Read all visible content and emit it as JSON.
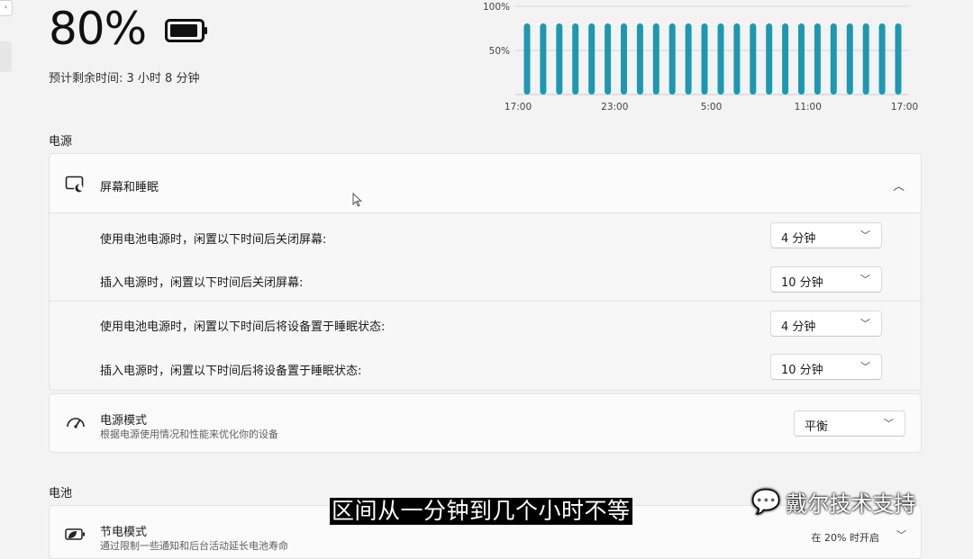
{
  "battery": {
    "percent": "80%",
    "remaining": "预计剩余时间: 3 小时 8 分钟"
  },
  "chart_data": {
    "type": "bar",
    "yticks": [
      "100%",
      "50%"
    ],
    "xticks": [
      "17:00",
      "23:00",
      "5:00",
      "11:00",
      "17:00"
    ],
    "values": [
      80,
      80,
      80,
      80,
      80,
      80,
      80,
      80,
      80,
      80,
      80,
      80,
      80,
      80,
      80,
      80,
      80,
      80,
      80,
      80,
      80,
      80,
      80,
      80
    ],
    "ylim": [
      0,
      100
    ],
    "bar_color": "#1e98b0",
    "grid": true
  },
  "power_section": {
    "label": "电源",
    "screen_sleep": {
      "title": "屏幕和睡眠",
      "expand_icon": "chevron-up-icon",
      "settings": [
        {
          "label": "使用电池电源时，闲置以下时间后关闭屏幕:",
          "value": "4 分钟"
        },
        {
          "label": "插入电源时，闲置以下时间后关闭屏幕:",
          "value": "10 分钟"
        },
        {
          "label": "使用电池电源时，闲置以下时间后将设备置于睡眠状态:",
          "value": "4 分钟"
        },
        {
          "label": "插入电源时，闲置以下时间后将设备置于睡眠状态:",
          "value": "10 分钟"
        }
      ]
    },
    "power_mode": {
      "title": "电源模式",
      "desc": "根据电源使用情况和性能来优化你的设备",
      "value": "平衡"
    }
  },
  "battery_section": {
    "label": "电池",
    "saver": {
      "title": "节电模式",
      "desc": "通过限制一些通知和后台活动延长电池寿命",
      "status": "在 20% 时开启"
    }
  },
  "overlay": {
    "subtitle": "区间从一分钟到几个小时不等",
    "watermark": "戴尔技术支持"
  }
}
